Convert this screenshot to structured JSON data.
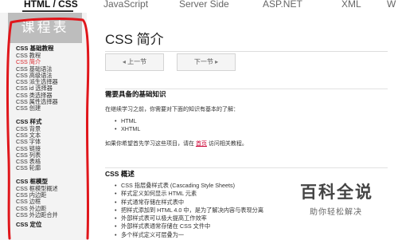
{
  "topnav": {
    "items": [
      "HTML / CSS",
      "JavaScript",
      "Server Side",
      "ASP.NET",
      "XML",
      "W"
    ]
  },
  "sidebar": {
    "title": "课程表",
    "sections": [
      {
        "title": "CSS 基础教程",
        "items": [
          "CSS 教程",
          "CSS 简介",
          "CSS 基础语法",
          "CSS 高级语法",
          "CSS 派生选择器",
          "CSS id 选择器",
          "CSS 类选择器",
          "CSS 属性选择器",
          "CSS 创建"
        ]
      },
      {
        "title": "CSS 样式",
        "items": [
          "CSS 背景",
          "CSS 文本",
          "CSS 字体",
          "CSS 链接",
          "CSS 列表",
          "CSS 表格",
          "CSS 轮廓"
        ]
      },
      {
        "title": "CSS 框模型",
        "items": [
          "CSS 框模型概述",
          "CSS 内边距",
          "CSS 边框",
          "CSS 外边距",
          "CSS 外边距合并"
        ]
      },
      {
        "title": "CSS 定位"
      }
    ],
    "active_item": "CSS 简介"
  },
  "main": {
    "title": "CSS 简介",
    "prev_label": "上一节",
    "next_label": "下一节",
    "prereq_heading": "需要具备的基础知识",
    "prereq_text": "在继续学习之前，你需要对下面的知识有基本的了解：",
    "prereq_items": [
      "HTML",
      "XHTML"
    ],
    "home_before": "如果你希望首先学习这些项目，请在 ",
    "home_link": "首页",
    "home_after": " 访问相关教程。",
    "overview_heading": "CSS 概述",
    "overview_items": [
      "CSS 指层叠样式表 (Cascading Style Sheets)",
      "样式定义如何显示 HTML 元素",
      "样式通常存储在样式表中",
      "把样式添加到 HTML 4.0 中，是为了解决内容与表现分离",
      "外部样式表可以极大提高工作效率",
      "外部样式表通常存储在 CSS 文件中",
      "多个样式定义可层叠为一"
    ]
  },
  "watermark": {
    "title": "百科全说",
    "subtitle": "助你轻松解决"
  },
  "colors": {
    "active_link": "#d8262b",
    "annotation": "#e0161b",
    "sidebar_head": "#bdbdbd"
  }
}
